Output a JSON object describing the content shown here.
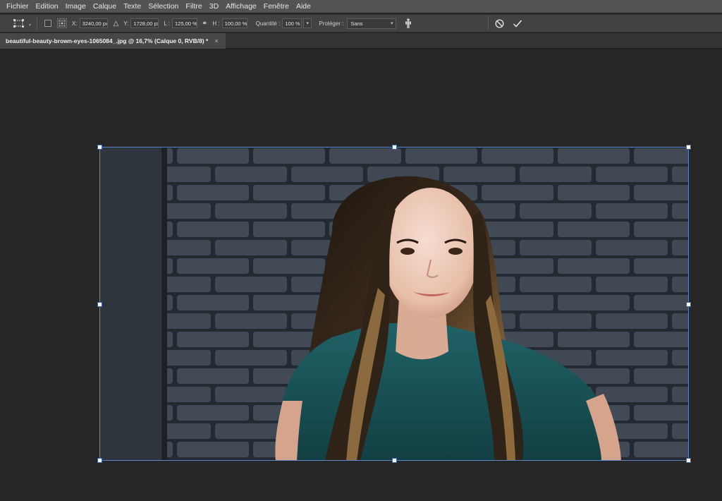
{
  "menu": [
    "Fichier",
    "Edition",
    "Image",
    "Calque",
    "Texte",
    "Sélection",
    "Filtre",
    "3D",
    "Affichage",
    "Fenêtre",
    "Aide"
  ],
  "options": {
    "x_label": "X:",
    "x_value": "3240,00 px",
    "y_label": "Y:",
    "y_value": "1728,00 px",
    "w_label": "L :",
    "w_value": "125,00 %",
    "h_label": "H :",
    "h_value": "100,00 %",
    "quantity_label": "Quantité :",
    "quantity_value": "100 %",
    "protect_label": "Protéger :",
    "protect_value": "Sans"
  },
  "tab": {
    "title": "beautiful-beauty-brown-eyes-1065084_.jpg @ 16,7% (Calque 0, RVB/8) *",
    "close": "×"
  },
  "icons": {
    "tool_preset": "transform-tool-icon",
    "angle": "delta-angle-icon",
    "link": "link-icon",
    "protect": "puppet-figure-icon",
    "cancel": "cancel-icon",
    "commit": "checkmark-icon"
  },
  "colors": {
    "menubar": "#535353",
    "optionsbar": "#424242",
    "canvas": "#262626",
    "selection": "#5b83c7",
    "brick": "#3e4650",
    "shirt": "#1a5c60"
  }
}
